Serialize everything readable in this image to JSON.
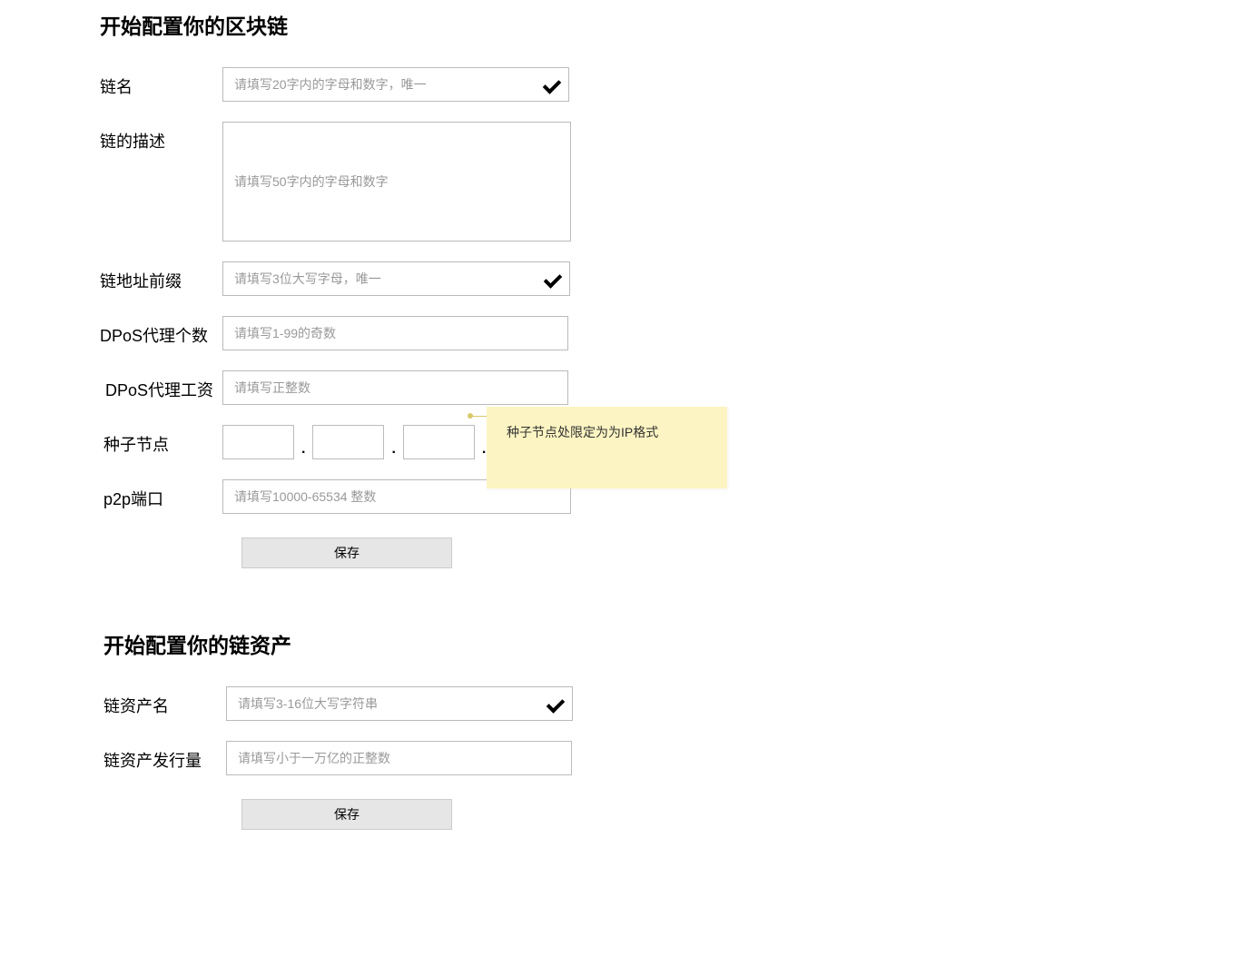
{
  "section1": {
    "title": "开始配置你的区块链",
    "fields": {
      "chainname": {
        "label": "链名",
        "placeholder": "请填写20字内的字母和数字，唯一"
      },
      "desc": {
        "label": "链的描述",
        "placeholder": "请填写50字内的字母和数字"
      },
      "prefix": {
        "label": "链地址前缀",
        "placeholder": "请填写3位大写字母，唯一"
      },
      "dpos_count": {
        "label": "DPoS代理个数",
        "placeholder": "请填写1-99的奇数"
      },
      "dpos_wage": {
        "label": "DPoS代理工资",
        "placeholder": "请填写正整数"
      },
      "seed": {
        "label": "种子节点"
      },
      "p2p": {
        "label": "p2p端口",
        "placeholder": "请填写10000-65534 整数"
      }
    },
    "save_label": "保存"
  },
  "section2": {
    "title": "开始配置你的链资产",
    "fields": {
      "assetname": {
        "label": "链资产名",
        "placeholder": "请填写3-16位大写字符串"
      },
      "assetissue": {
        "label": "链资产发行量",
        "placeholder": "请填写小于一万亿的正整数"
      }
    },
    "save_label": "保存"
  },
  "annotation": {
    "text": "种子节点处限定为为IP格式"
  },
  "dot": "."
}
